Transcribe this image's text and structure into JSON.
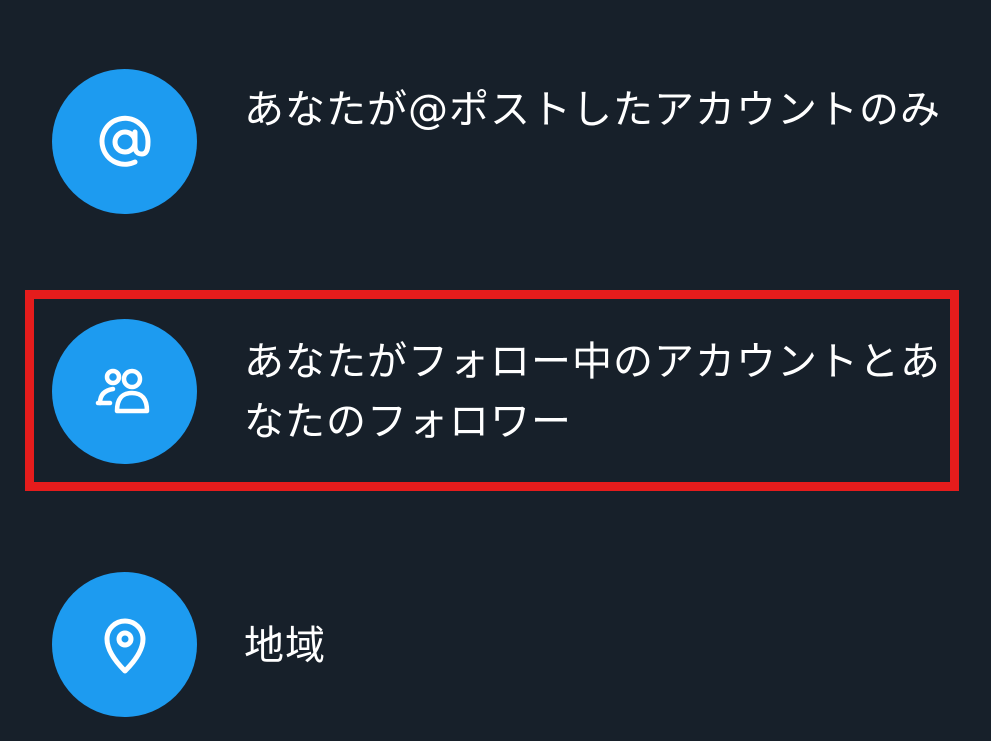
{
  "reply_options": [
    {
      "label": "あなたが@ポストしたアカウントのみ",
      "icon": "at-sign-icon"
    },
    {
      "label": "あなたがフォロー中のアカウントとあなたのフォロワー",
      "icon": "people-icon",
      "highlighted": true
    },
    {
      "label": "地域",
      "icon": "location-pin-icon"
    }
  ],
  "colors": {
    "background": "#17202a",
    "icon_circle": "#1d9bf0",
    "text": "#ffffff",
    "highlight_border": "#e51c1c"
  }
}
